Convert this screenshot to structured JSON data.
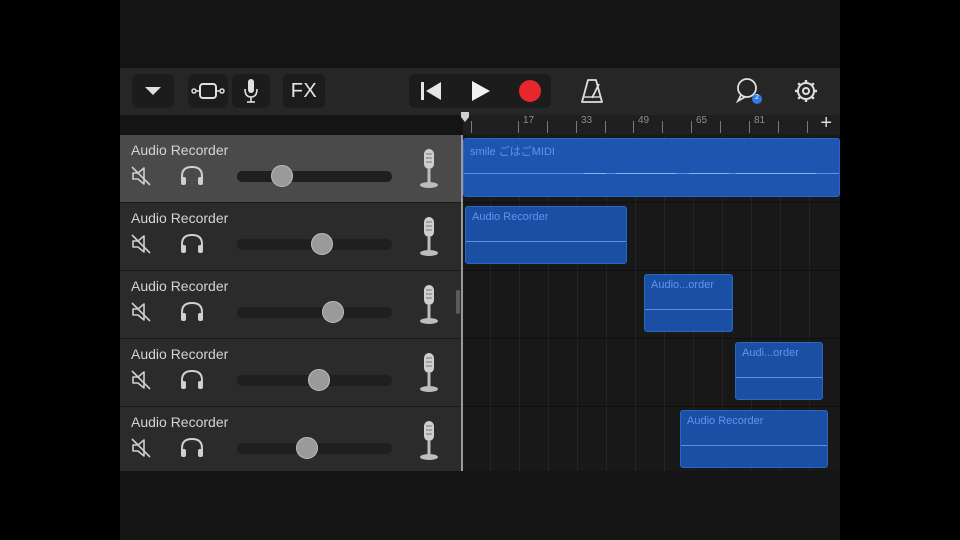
{
  "toolbar": {
    "fx_label": "FX",
    "icons": [
      "chevron-down-icon",
      "track-view-icon",
      "microphone-icon",
      "rewind-icon",
      "play-icon",
      "record-icon",
      "metronome-icon",
      "loops-icon",
      "settings-icon"
    ],
    "record_color": "#e8262d",
    "loops_badge": "2"
  },
  "ruler": {
    "bar_numbers": [
      "17",
      "33",
      "49",
      "65",
      "81"
    ],
    "add_label": "+"
  },
  "tracks": [
    {
      "name": "Audio Recorder",
      "volume": 0.29,
      "selected": true
    },
    {
      "name": "Audio Recorder",
      "volume": 0.55,
      "selected": false
    },
    {
      "name": "Audio Recorder",
      "volume": 0.62,
      "selected": false
    },
    {
      "name": "Audio Recorder",
      "volume": 0.53,
      "selected": false
    },
    {
      "name": "Audio Recorder",
      "volume": 0.45,
      "selected": false
    }
  ],
  "regions": [
    {
      "label": "smile ごはごMIDI"
    },
    {
      "label": "Audio Recorder"
    },
    {
      "label": "Audio...order"
    },
    {
      "label": "Audi...order"
    },
    {
      "label": "Audio Recorder"
    }
  ],
  "colors": {
    "region_blue": "#1b4fa3",
    "accent_blue": "#2a66c4"
  }
}
